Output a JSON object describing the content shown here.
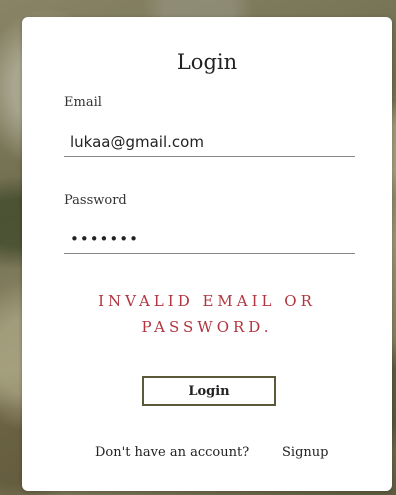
{
  "form": {
    "title": "Login",
    "email_label": "Email",
    "email_value": "lukaa@gmail.com",
    "password_label": "Password",
    "password_value": "•••••••",
    "error_message": "INVALID EMAIL OR PASSWORD.",
    "login_button_label": "Login",
    "no_account_text": "Don't have an account?",
    "signup_link_label": "Signup"
  },
  "colors": {
    "error": "#b0353f",
    "button_border": "#5a5a3a",
    "card_background": "#ffffff"
  }
}
